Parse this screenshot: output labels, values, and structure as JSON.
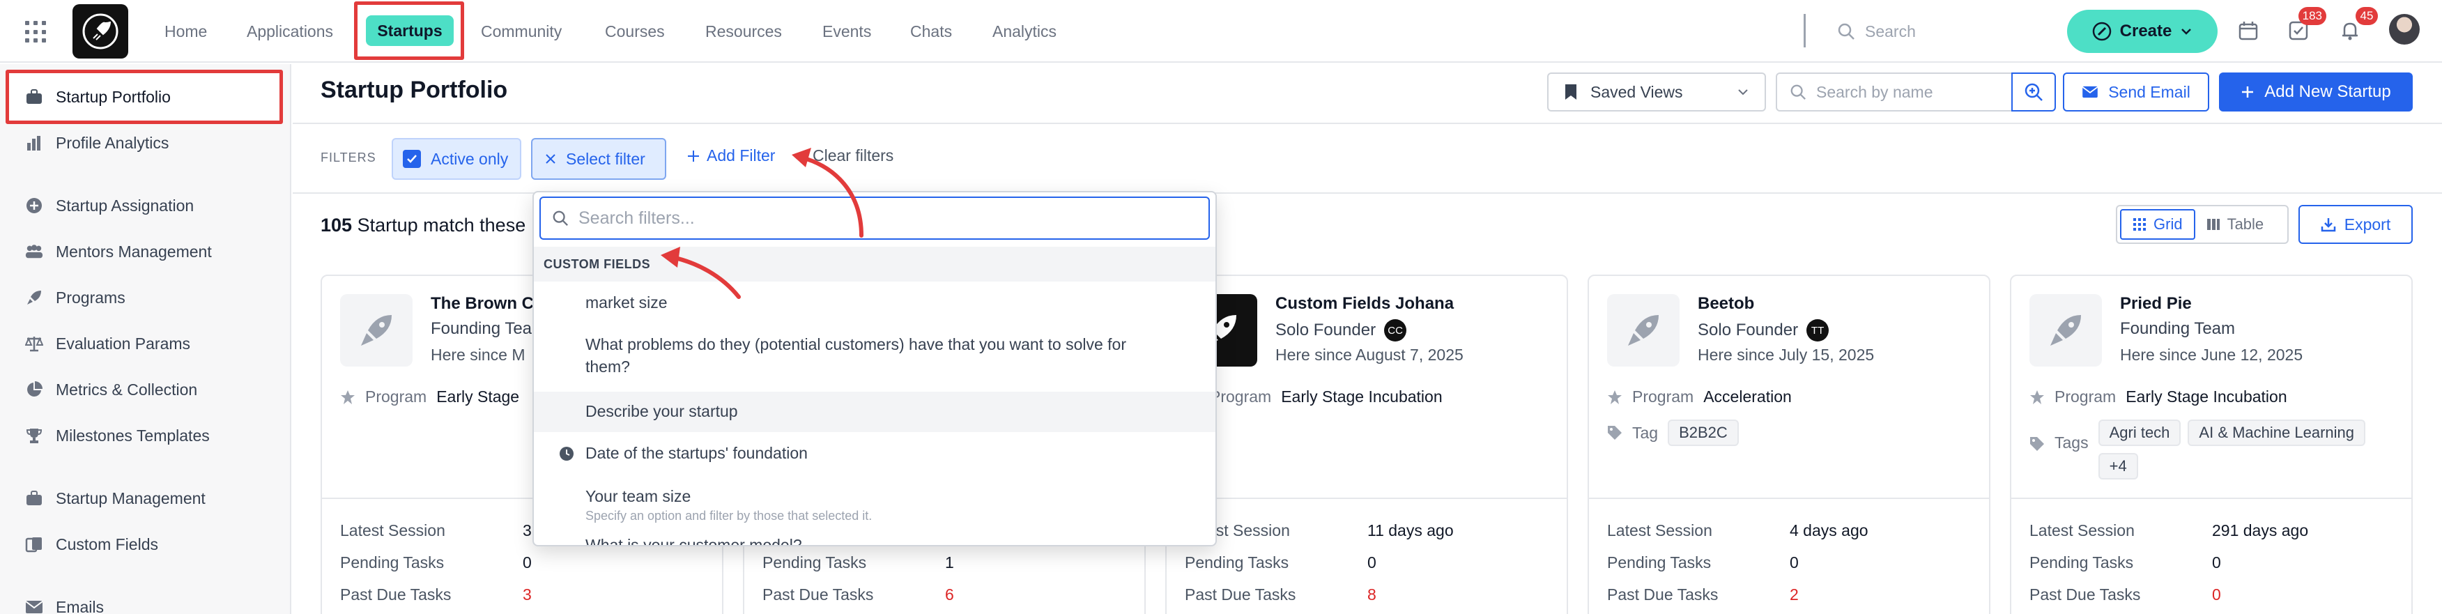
{
  "topnav": {
    "items": [
      {
        "label": "Home"
      },
      {
        "label": "Applications"
      },
      {
        "label": "Startups"
      },
      {
        "label": "Community"
      },
      {
        "label": "Courses"
      },
      {
        "label": "Resources"
      },
      {
        "label": "Events"
      },
      {
        "label": "Chats"
      },
      {
        "label": "Analytics"
      }
    ],
    "search_placeholder": "Search",
    "create_label": "Create",
    "tasks_badge": "183",
    "notifications_badge": "45"
  },
  "sidebar": {
    "items": [
      {
        "label": "Startup Portfolio",
        "icon": "briefcase-icon"
      },
      {
        "label": "Profile Analytics",
        "icon": "bar-chart-icon"
      },
      {
        "label": "Startup Assignation",
        "icon": "circle-plus-icon"
      },
      {
        "label": "Mentors Management",
        "icon": "users-icon"
      },
      {
        "label": "Programs",
        "icon": "rocket-icon"
      },
      {
        "label": "Evaluation Params",
        "icon": "scale-icon"
      },
      {
        "label": "Metrics & Collection",
        "icon": "pie-chart-icon"
      },
      {
        "label": "Milestones Templates",
        "icon": "trophy-icon"
      },
      {
        "label": "Startup Management",
        "icon": "briefcase-icon"
      },
      {
        "label": "Custom Fields",
        "icon": "document-icon"
      },
      {
        "label": "Emails",
        "icon": "mail-icon"
      }
    ]
  },
  "page": {
    "title": "Startup Portfolio",
    "saved_views_label": "Saved Views",
    "name_search_placeholder": "Search by name",
    "send_email_label": "Send Email",
    "add_startup_label": "Add New Startup"
  },
  "filters": {
    "label": "FILTERS",
    "active_only_label": "Active only",
    "select_filter_label": "Select filter",
    "add_filter_label": "Add Filter",
    "clear_filters_label": "Clear filters"
  },
  "results": {
    "count": "105",
    "text": "Startup match these",
    "grid_label": "Grid",
    "table_label": "Table",
    "export_label": "Export"
  },
  "dropdown": {
    "search_placeholder": "Search filters...",
    "section_label": "CUSTOM FIELDS",
    "options": [
      {
        "label": "market size"
      },
      {
        "label": "What problems do they (potential customers) have that you want to solve for them?"
      },
      {
        "label": "Describe your startup"
      },
      {
        "label": "Date of the startups' foundation"
      },
      {
        "label": "Your team size",
        "sub": "Specify an option and filter by those that selected it."
      },
      {
        "label": "What is your customer model?"
      }
    ]
  },
  "cards": [
    {
      "name": "The Brown Cl",
      "role": "Founding Tea",
      "since": "Here since M",
      "program_label": "Program",
      "program": "Early Stage",
      "latest_session": "3",
      "pending_tasks": "0",
      "past_due": "3"
    },
    {
      "latest_session": "",
      "pending_tasks": "1",
      "past_due": "6"
    },
    {
      "name": "Custom Fields Johana",
      "role": "Solo Founder",
      "initials": "CC",
      "since": "Here since August 7, 2025",
      "program_label": "Program",
      "program": "Early Stage Incubation",
      "latest_session": "11 days ago",
      "pending_tasks": "0",
      "past_due": "8"
    },
    {
      "name": "Beetob",
      "role": "Solo Founder",
      "initials": "TT",
      "since": "Here since July 15, 2025",
      "program_label": "Program",
      "program": "Acceleration",
      "tag_label": "Tag",
      "tags": [
        "B2B2C"
      ],
      "latest_session": "4 days ago",
      "pending_tasks": "0",
      "past_due": "2"
    },
    {
      "name": "Pried Pie",
      "role": "Founding Team",
      "since": "Here since June 12, 2025",
      "program_label": "Program",
      "program": "Early Stage Incubation",
      "tag_label": "Tags",
      "tags": [
        "Agri tech",
        "AI & Machine Learning",
        "+4"
      ],
      "latest_session": "291 days ago",
      "pending_tasks": "0",
      "past_due": "0"
    }
  ],
  "card_labels": {
    "latest_session": "Latest Session",
    "pending_tasks": "Pending Tasks",
    "past_due": "Past Due Tasks"
  },
  "colors": {
    "accent": "#2563eb",
    "brand_teal": "#4ddfc6",
    "annotation_red": "#e23b3b",
    "overdue_red": "#dc2626"
  }
}
